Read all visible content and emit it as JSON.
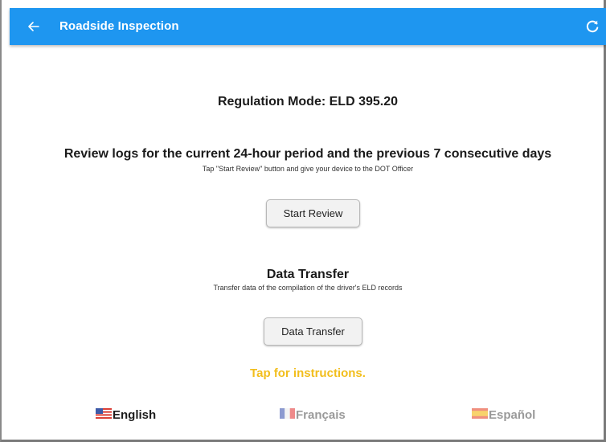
{
  "appbar": {
    "title": "Roadside Inspection",
    "back_icon": "arrow-left-icon",
    "refresh_icon": "refresh-icon",
    "color": "#1e96f0"
  },
  "regulation": {
    "text": "Regulation Mode: ELD 395.20"
  },
  "review": {
    "title": "Review logs for the current 24-hour period and the previous 7 consecutive days",
    "subtitle": "Tap \"Start Review\" button and give your device to the DOT Officer",
    "button_label": "Start Review"
  },
  "transfer": {
    "title": "Data Transfer",
    "subtitle": "Transfer data of the compilation of the driver's ELD records",
    "button_label": "Data Transfer"
  },
  "instructions": {
    "text": "Tap for instructions.",
    "color": "#f2be1c"
  },
  "languages": [
    {
      "label": "English",
      "flag": "us-flag-icon",
      "selected": true
    },
    {
      "label": "Français",
      "flag": "france-flag-icon",
      "selected": false
    },
    {
      "label": "Español",
      "flag": "spain-flag-icon",
      "selected": false
    }
  ]
}
